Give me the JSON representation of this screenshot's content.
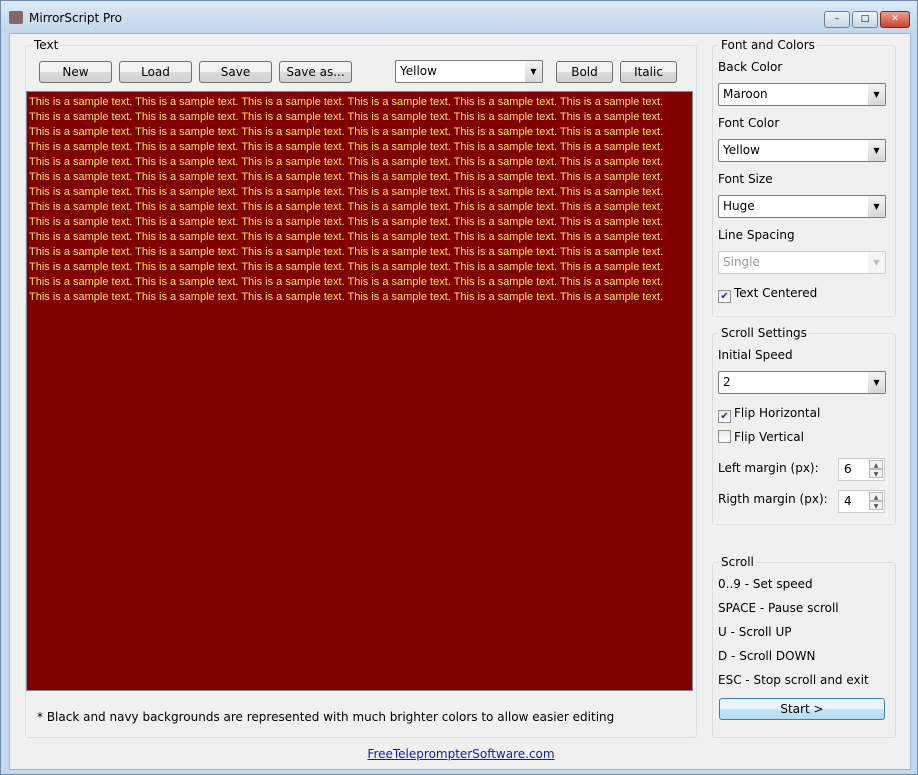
{
  "window": {
    "title": "MirrorScript Pro",
    "minimize": "–",
    "maximize": "□",
    "close": "✕"
  },
  "text_group": {
    "legend": "Text",
    "new": "New",
    "load": "Load",
    "save": "Save",
    "save_as": "Save as...",
    "color_select": "Yellow",
    "bold": "Bold",
    "italic": "Italic",
    "content_line": "This is a sample text. This is a sample text. This is a sample text. This is a sample text. This is a sample text. This is a sample text.",
    "line_count": 14,
    "note": "* Black and navy backgrounds are represented with much brighter colors to allow easier editing",
    "back_color_hex": "#800000",
    "font_color_hex": "#ffe066"
  },
  "font_colors": {
    "legend": "Font and Colors",
    "back_color_label": "Back Color",
    "back_color": "Maroon",
    "font_color_label": "Font Color",
    "font_color": "Yellow",
    "font_size_label": "Font Size",
    "font_size": "Huge",
    "line_spacing_label": "Line Spacing",
    "line_spacing": "Single",
    "text_centered": "Text Centered",
    "text_centered_checked": true
  },
  "scroll_settings": {
    "legend": "Scroll Settings",
    "initial_speed_label": "Initial Speed",
    "initial_speed": "2",
    "flip_h": "Flip Horizontal",
    "flip_h_checked": true,
    "flip_v": "Flip Vertical",
    "flip_v_checked": false,
    "left_margin_label": "Left margin (px):",
    "left_margin": "6",
    "right_margin_label": "Rigth margin (px):",
    "right_margin": "4"
  },
  "scroll": {
    "legend": "Scroll",
    "keys": [
      "0..9  - Set speed",
      "SPACE - Pause scroll",
      "U - Scroll UP",
      "D - Scroll DOWN",
      "ESC - Stop scroll and exit"
    ],
    "start": "Start >"
  },
  "footer_link": "FreeTeleprompterSoftware.com"
}
